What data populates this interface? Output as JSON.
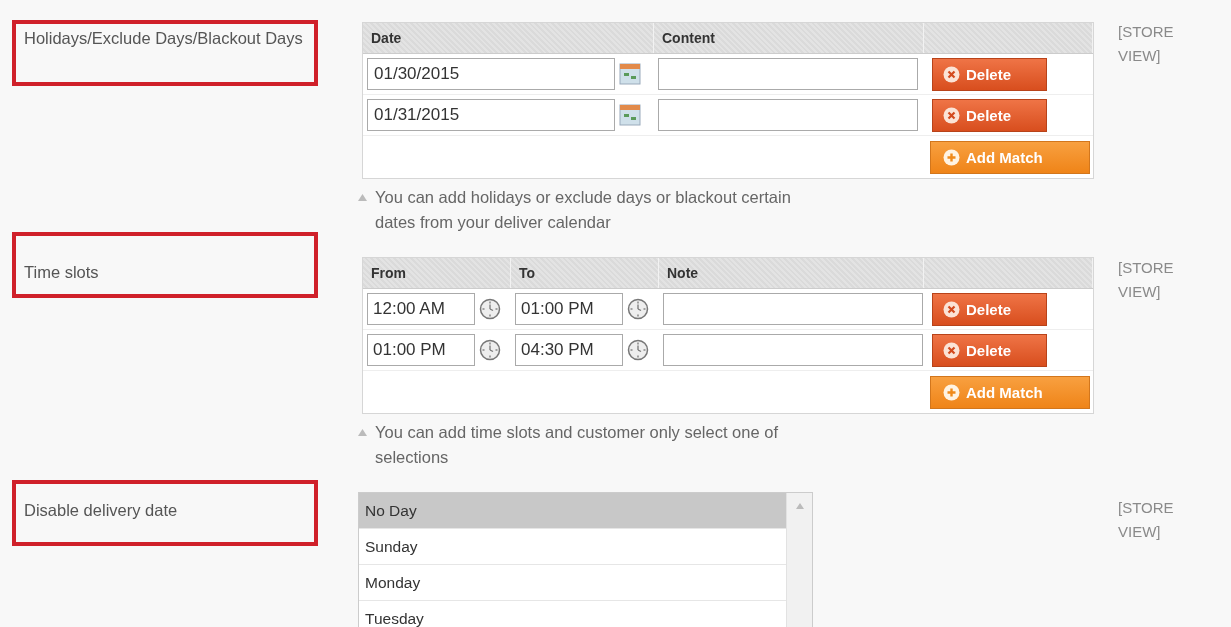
{
  "sections": [
    {
      "label": "Holidays/Exclude Days/Blackout Days",
      "kind": "table",
      "columns": [
        "Date",
        "Content"
      ],
      "rows": [
        {
          "cells": [
            {
              "kind": "date",
              "value": "01/30/2015"
            },
            {
              "kind": "text"
            }
          ],
          "button": "Delete"
        },
        {
          "cells": [
            {
              "kind": "date",
              "value": "01/31/2015"
            },
            {
              "kind": "text"
            }
          ],
          "button": "Delete"
        }
      ],
      "add_button": "Add Match",
      "hint": "You can add holidays or exclude days or blackout certain dates from your deliver calendar",
      "scope": "[STORE VIEW]"
    },
    {
      "label": "Time slots",
      "kind": "table",
      "columns": [
        "From",
        "To",
        "Note"
      ],
      "rows": [
        {
          "cells": [
            {
              "kind": "time",
              "value": "12:00 AM"
            },
            {
              "kind": "time",
              "value": "01:00 PM"
            },
            {
              "kind": "text"
            }
          ],
          "button": "Delete"
        },
        {
          "cells": [
            {
              "kind": "time",
              "value": "01:00 PM"
            },
            {
              "kind": "time",
              "value": "04:30 PM"
            },
            {
              "kind": "text"
            }
          ],
          "button": "Delete"
        }
      ],
      "add_button": "Add Match",
      "hint": "You can add time slots and customer only select one of selections",
      "scope": "[STORE VIEW]"
    },
    {
      "label": "Disable delivery date",
      "kind": "listbox",
      "options": [
        {
          "label": "No Day",
          "selected": true
        },
        {
          "label": "Sunday",
          "selected": false
        },
        {
          "label": "Monday",
          "selected": false
        },
        {
          "label": "Tuesday",
          "selected": false
        }
      ],
      "scope": "[STORE VIEW]"
    }
  ]
}
